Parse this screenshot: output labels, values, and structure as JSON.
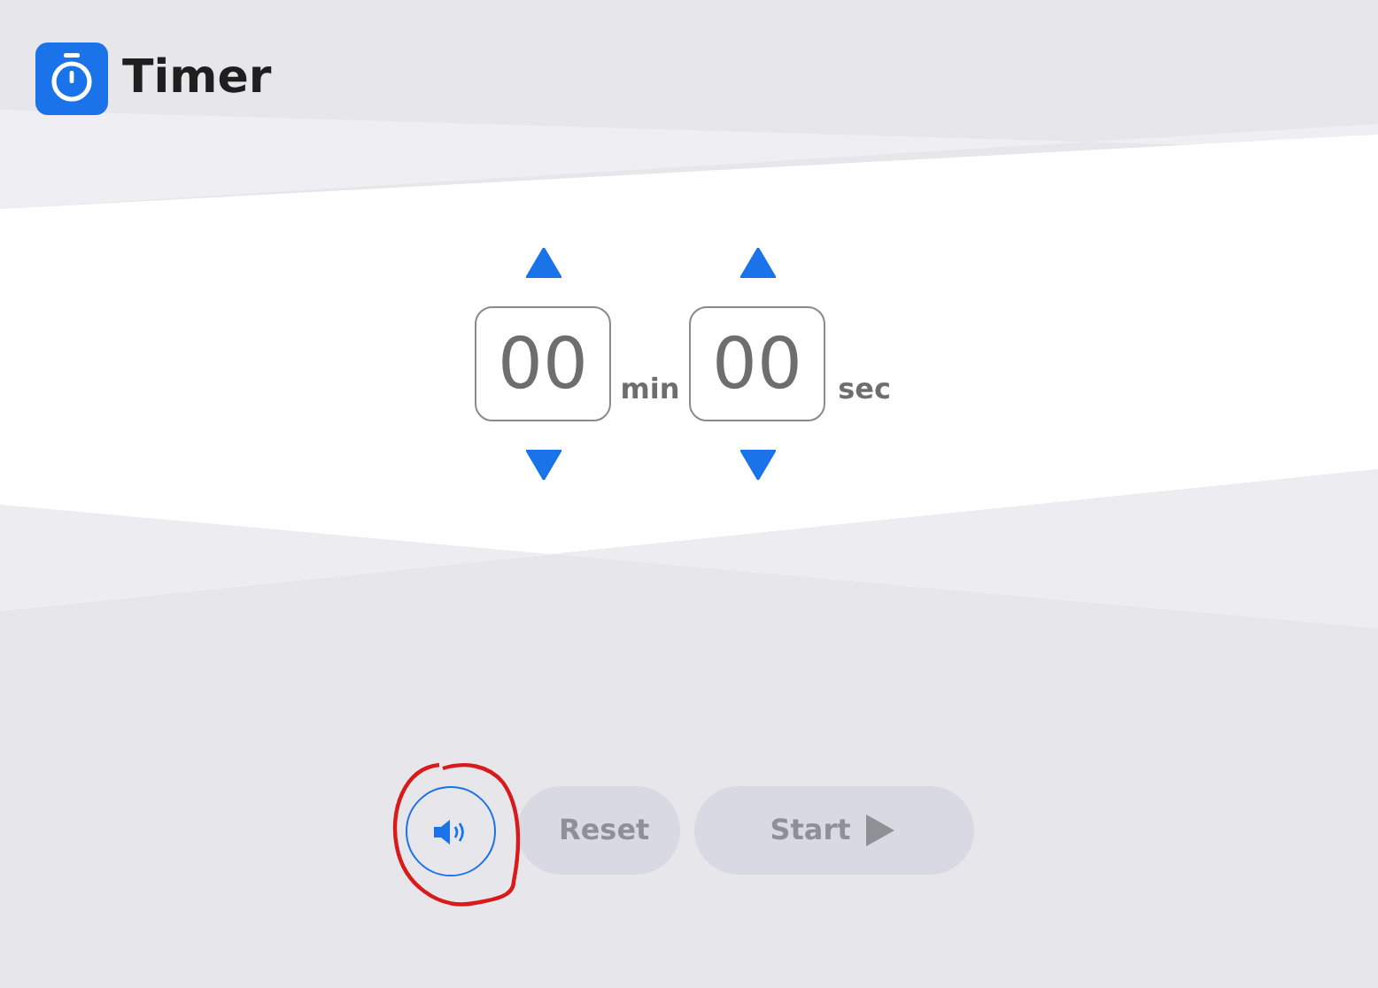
{
  "header": {
    "title": "Timer"
  },
  "spinners": [
    {
      "value": "00",
      "unit": "min"
    },
    {
      "value": "00",
      "unit": "sec"
    }
  ],
  "buttons": [
    {
      "kind": "sound",
      "disabled": false
    },
    {
      "kind": "text",
      "label": "Reset",
      "disabled": true
    },
    {
      "kind": "start",
      "label": "Start",
      "disabled": true
    }
  ]
}
